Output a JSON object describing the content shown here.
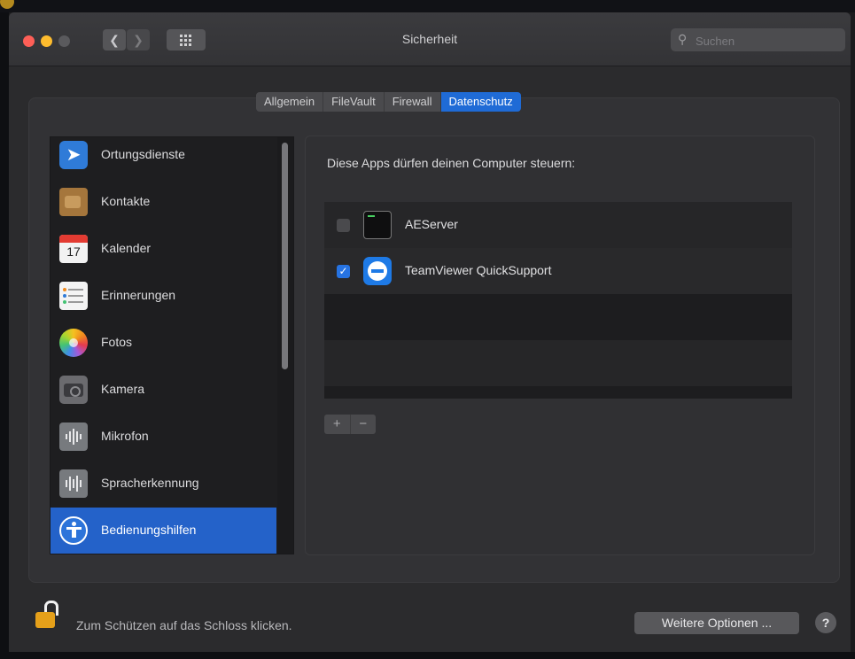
{
  "window": {
    "title": "Sicherheit",
    "search_placeholder": "Suchen"
  },
  "tabs": [
    "Allgemein",
    "FileVault",
    "Firewall",
    "Datenschutz"
  ],
  "active_tab": "Datenschutz",
  "sidebar": {
    "items": [
      {
        "label": "Ortungsdienste",
        "icon": "location-icon"
      },
      {
        "label": "Kontakte",
        "icon": "contacts-icon"
      },
      {
        "label": "Kalender",
        "icon": "calendar-icon",
        "badge": "17"
      },
      {
        "label": "Erinnerungen",
        "icon": "reminders-icon"
      },
      {
        "label": "Fotos",
        "icon": "photos-icon"
      },
      {
        "label": "Kamera",
        "icon": "camera-icon"
      },
      {
        "label": "Mikrofon",
        "icon": "microphone-icon"
      },
      {
        "label": "Spracherkennung",
        "icon": "speech-recognition-icon"
      },
      {
        "label": "Bedienungshilfen",
        "icon": "accessibility-icon",
        "selected": true
      }
    ]
  },
  "panel": {
    "heading": "Diese Apps dürfen deinen Computer steuern:",
    "apps": [
      {
        "name": "AEServer",
        "checked": false,
        "icon": "terminal-icon"
      },
      {
        "name": "TeamViewer QuickSupport",
        "checked": true,
        "icon": "teamviewer-icon"
      }
    ],
    "add_label": "+",
    "remove_label": "−"
  },
  "footer": {
    "lock_text": "Zum Schützen auf das Schloss klicken.",
    "more_options": "Weitere Optionen ...",
    "help": "?"
  },
  "colors": {
    "accent": "#2462c9",
    "tab_active": "#1f6bd6",
    "checkbox_checked": "#2673e2",
    "lock": "#e5a01a"
  }
}
